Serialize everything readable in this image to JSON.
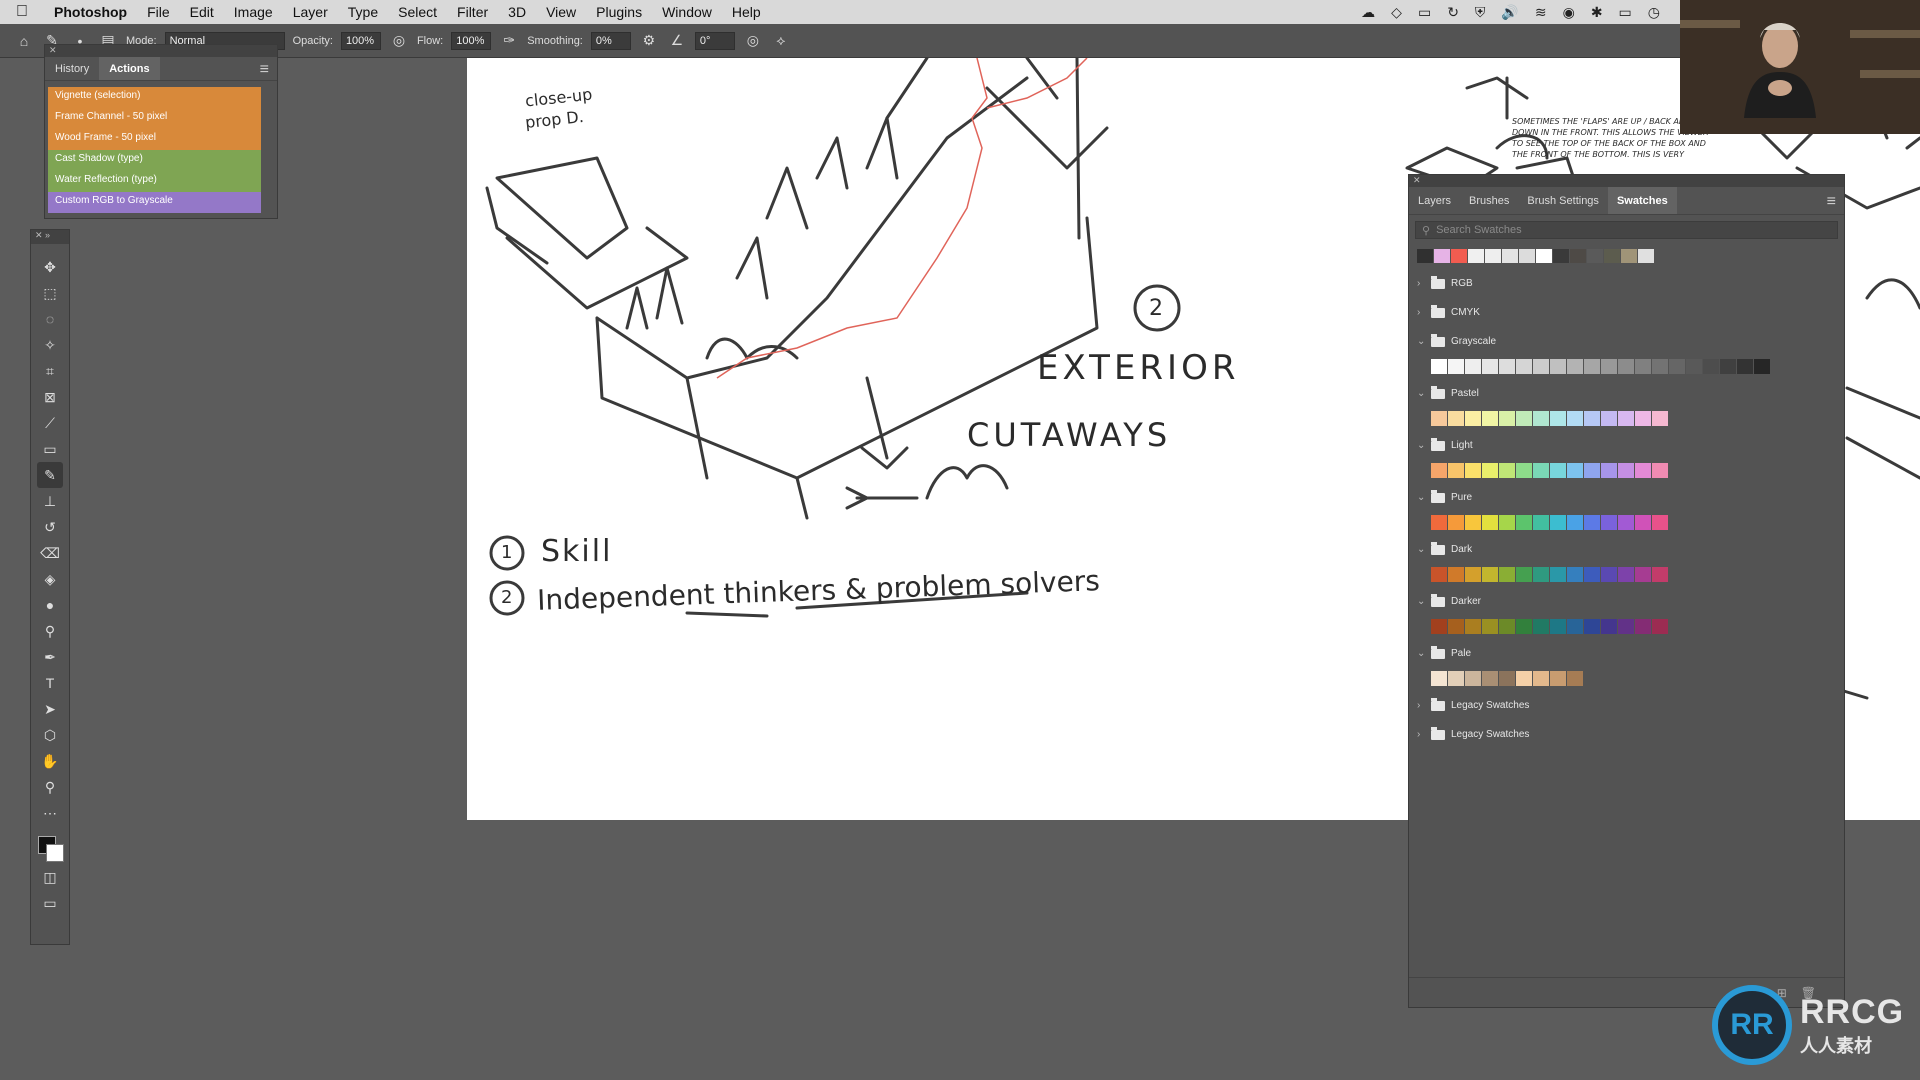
{
  "menubar": {
    "app_name": "Photoshop",
    "items": [
      "File",
      "Edit",
      "Image",
      "Layer",
      "Type",
      "Select",
      "Filter",
      "3D",
      "View",
      "Plugins",
      "Window",
      "Help"
    ]
  },
  "options_bar": {
    "mode_label": "Mode:",
    "mode_value": "Normal",
    "opacity_label": "Opacity:",
    "opacity_value": "100%",
    "flow_label": "Flow:",
    "flow_value": "100%",
    "smoothing_label": "Smoothing:",
    "smoothing_value": "0%",
    "angle_value": "0°"
  },
  "actions_panel": {
    "tabs": [
      "History",
      "Actions"
    ],
    "active_tab": "Actions",
    "items": [
      {
        "label": "Vignette (selection)",
        "color": "#d8893a"
      },
      {
        "label": "Frame Channel - 50 pixel",
        "color": "#d8893a"
      },
      {
        "label": "Wood Frame - 50 pixel",
        "color": "#d8893a"
      },
      {
        "label": "Cast Shadow (type)",
        "color": "#7fa553"
      },
      {
        "label": "Water Reflection (type)",
        "color": "#7fa553"
      },
      {
        "label": "Custom RGB to Grayscale",
        "color": "#9478c8"
      }
    ]
  },
  "swatches_panel": {
    "tabs": [
      "Layers",
      "Brushes",
      "Brush Settings",
      "Swatches"
    ],
    "active_tab": "Swatches",
    "search_placeholder": "Search Swatches",
    "recent": [
      "#303030",
      "#e6b3e6",
      "#f25c50",
      "#f0f0f0",
      "#eeeeee",
      "#e3e3e3",
      "#dcdcdc",
      "#ffffff",
      "#3a3a3a",
      "#4e4a46",
      "#5a5a5a",
      "#5c5c4e",
      "#a09478",
      "#e0e0e0"
    ],
    "groups": [
      {
        "name": "RGB",
        "expanded": false,
        "colors": []
      },
      {
        "name": "CMYK",
        "expanded": false,
        "colors": []
      },
      {
        "name": "Grayscale",
        "expanded": true,
        "colors": [
          "#ffffff",
          "#f5f5f5",
          "#eeeeee",
          "#e6e6e6",
          "#dddddd",
          "#d5d5d5",
          "#cccccc",
          "#c0c0c0",
          "#b3b3b3",
          "#a6a6a6",
          "#999999",
          "#8c8c8c",
          "#808080",
          "#737373",
          "#666666",
          "#595959",
          "#4d4d4d",
          "#404040",
          "#333333",
          "#262626"
        ]
      },
      {
        "name": "Pastel",
        "expanded": true,
        "colors": [
          "#f7c99b",
          "#f9dc9f",
          "#fbeea3",
          "#f1f5a5",
          "#d9f0a7",
          "#c0eab8",
          "#b0e6d0",
          "#aee6e8",
          "#b2dbf4",
          "#b6c8f5",
          "#c4b9f2",
          "#d8b8f0",
          "#eeb8e6",
          "#f5b8d0"
        ]
      },
      {
        "name": "Light",
        "expanded": true,
        "colors": [
          "#f6a56a",
          "#f8c46a",
          "#fbe06a",
          "#e9ef6b",
          "#bfe676",
          "#8ddc8a",
          "#7ad8b6",
          "#78d6dc",
          "#7dc3ef",
          "#8fa5ef",
          "#a795ea",
          "#c58fe4",
          "#e48ad6",
          "#f08bb2"
        ]
      },
      {
        "name": "Pure",
        "expanded": true,
        "colors": [
          "#f06a3c",
          "#f59a3a",
          "#f8c63c",
          "#e2e03e",
          "#a6d64a",
          "#5cc46c",
          "#42bfa0",
          "#3cbdd0",
          "#4aa2e6",
          "#5c7ae6",
          "#7a62dc",
          "#a25ad4",
          "#d052b8",
          "#e8528a"
        ]
      },
      {
        "name": "Dark",
        "expanded": true,
        "colors": [
          "#c9542a",
          "#d07a2a",
          "#d4a02c",
          "#c2b62e",
          "#8aae34",
          "#45a050",
          "#2f9a80",
          "#2a98a8",
          "#357fbe",
          "#3d5cbc",
          "#5a49b2",
          "#7d42aa",
          "#a63c92",
          "#c23c6a"
        ]
      },
      {
        "name": "Darker",
        "expanded": true,
        "colors": [
          "#a2401e",
          "#a6601e",
          "#aa7e20",
          "#9a9022",
          "#6c8a28",
          "#32803c",
          "#217a64",
          "#1e7886",
          "#286498",
          "#2e4696",
          "#44368e",
          "#623288",
          "#842c74",
          "#9c2c52"
        ]
      },
      {
        "name": "Pale",
        "expanded": true,
        "colors": [
          "#f4e4d2",
          "#e2cfb8",
          "#cbb59c",
          "#a98f74",
          "#8b735c",
          "#f4d0a8",
          "#e2b88c",
          "#c89c70",
          "#a67c54"
        ]
      },
      {
        "name": "Legacy Swatches",
        "expanded": false,
        "colors": []
      },
      {
        "name": "Legacy Swatches",
        "expanded": false,
        "colors": []
      }
    ]
  },
  "canvas": {
    "note_closeup": "close-up",
    "note_prop": "prop D.",
    "note_circle2": "2",
    "note_exterior": "EXTERIOR",
    "note_cutaways": "CUTAWAYS",
    "list_1_num": "1",
    "list_1_text": "Skill",
    "list_2_num": "2",
    "list_2_text": "Independent thinkers & problem solvers",
    "comic_caption": "SOMETIMES THE 'FLAPS' ARE UP / BACK AND DOWN IN THE FRONT. THIS ALLOWS THE VIEWER TO SEE THE TOP OF THE BACK OF THE BOX AND THE FRONT OF THE BOTTOM. THIS IS VERY"
  },
  "watermark": {
    "main": "RRCG",
    "sub": "人人素材"
  },
  "colors": {
    "ui_bg": "#535353",
    "workspace": "#5c5c5c",
    "accent_red_line": "#e0645a"
  }
}
